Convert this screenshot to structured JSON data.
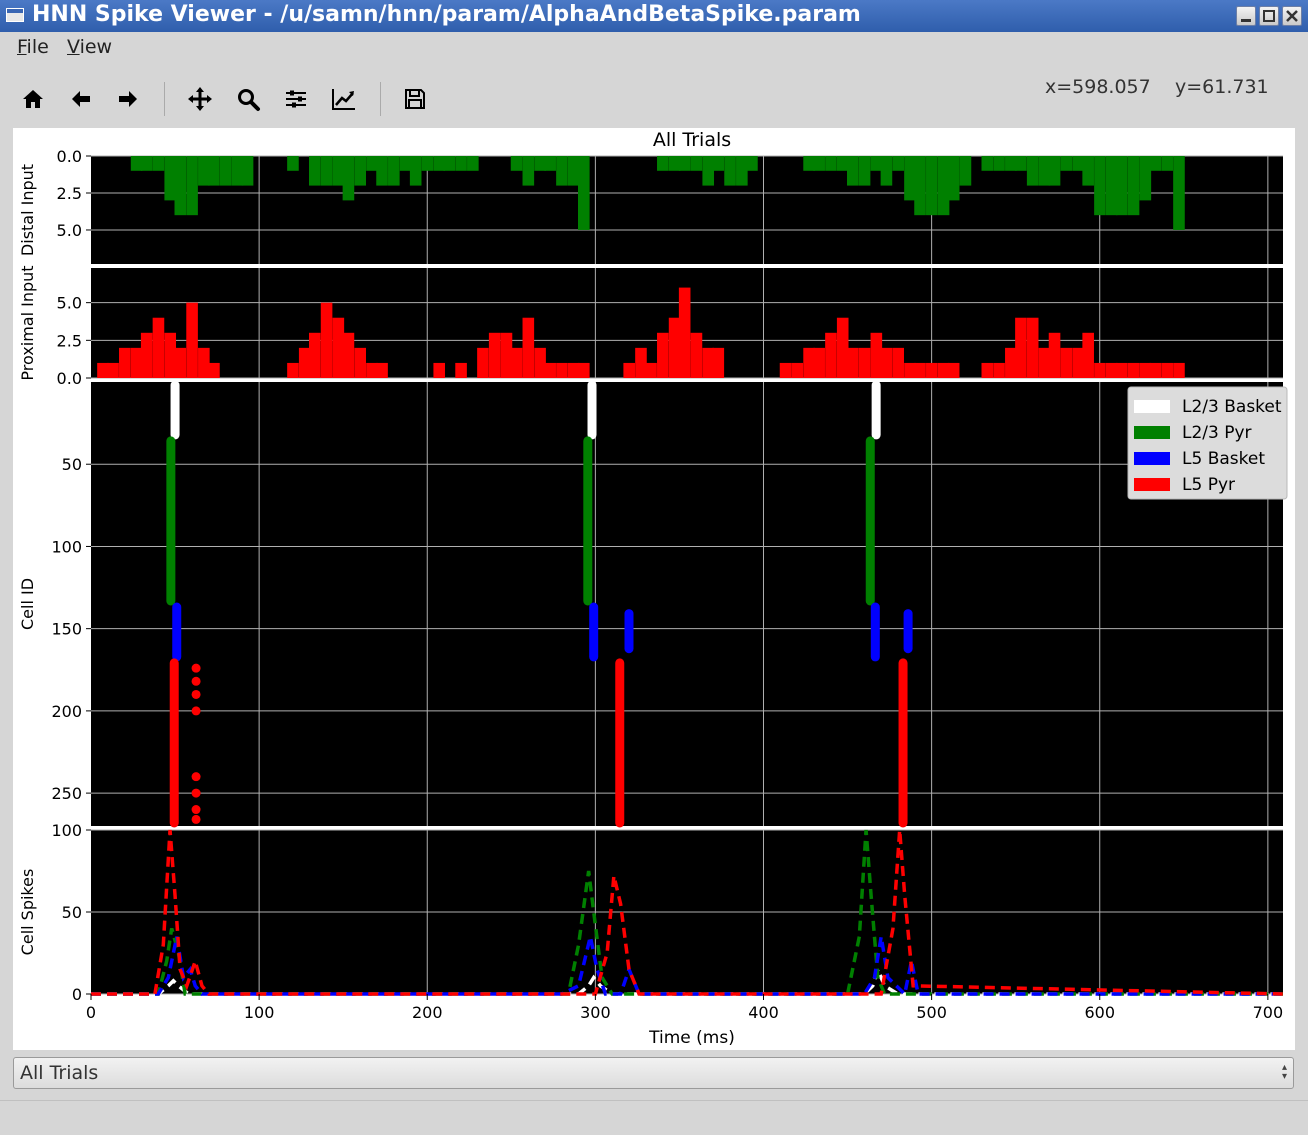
{
  "window": {
    "title": "HNN Spike Viewer - /u/samn/hnn/param/AlphaAndBetaSpike.param"
  },
  "menu": {
    "items": [
      {
        "first": "F",
        "rest": "ile"
      },
      {
        "first": "V",
        "rest": "iew"
      }
    ]
  },
  "toolbar": {
    "icons": [
      "home-icon",
      "back-arrow-icon",
      "forward-arrow-icon",
      "pan-icon",
      "zoom-icon",
      "subplots-config-icon",
      "edit-axis-icon",
      "save-icon"
    ],
    "coord_x": "x=598.057",
    "coord_y": "y=61.731"
  },
  "figure": {
    "title": "All Trials",
    "xlabel": "Time (ms)",
    "x_ticks": [
      "0",
      "100",
      "200",
      "300",
      "400",
      "500",
      "600",
      "700"
    ]
  },
  "chart_data": [
    {
      "type": "bar",
      "panel": "distal",
      "ylabel": "Distal Input",
      "ylim": [
        0,
        7.3
      ],
      "inverted_y": true,
      "y_ticks": [
        "0.0",
        "2.5",
        "5.0"
      ],
      "bin_width_ms": 6.66,
      "color": "#008000",
      "x": [
        27,
        33,
        40,
        47,
        53,
        60,
        67,
        73,
        80,
        87,
        93,
        120,
        133,
        140,
        147,
        153,
        160,
        167,
        173,
        180,
        187,
        193,
        200,
        207,
        213,
        220,
        227,
        253,
        260,
        267,
        273,
        280,
        287,
        293,
        340,
        347,
        353,
        360,
        367,
        373,
        380,
        387,
        393,
        427,
        433,
        440,
        447,
        453,
        460,
        467,
        473,
        480,
        487,
        493,
        500,
        507,
        513,
        520,
        533,
        540,
        547,
        553,
        560,
        567,
        573,
        580,
        587,
        593,
        600,
        607,
        613,
        620,
        627,
        633,
        640,
        647
      ],
      "values": [
        1,
        1,
        1,
        3,
        4,
        4,
        2,
        2,
        2,
        2,
        2,
        1,
        2,
        2,
        2,
        3,
        2,
        1,
        2,
        2,
        1,
        2,
        1,
        1,
        1,
        1,
        1,
        1,
        2,
        1,
        1,
        2,
        2,
        5,
        1,
        1,
        1,
        1,
        2,
        1,
        2,
        2,
        1,
        1,
        1,
        1,
        1,
        2,
        2,
        1,
        2,
        1,
        3,
        4,
        4,
        4,
        3,
        2,
        1,
        1,
        1,
        1,
        2,
        2,
        2,
        1,
        1,
        2,
        4,
        4,
        4,
        4,
        3,
        1,
        1,
        5
      ],
      "_note": "bars across the row as counts per bin"
    },
    {
      "type": "bar",
      "panel": "proximal",
      "ylabel": "Proximal Input",
      "ylim": [
        0,
        7.3
      ],
      "y_ticks": [
        "0.0",
        "2.5",
        "5.0"
      ],
      "bin_width_ms": 6.66,
      "color": "#ff0000",
      "x": [
        7,
        13,
        20,
        27,
        33,
        40,
        47,
        53,
        60,
        67,
        73,
        120,
        127,
        133,
        140,
        147,
        153,
        160,
        167,
        173,
        207,
        220,
        233,
        240,
        247,
        253,
        260,
        267,
        273,
        280,
        287,
        293,
        320,
        327,
        333,
        340,
        347,
        353,
        360,
        367,
        373,
        413,
        420,
        427,
        433,
        440,
        447,
        453,
        460,
        467,
        473,
        480,
        487,
        493,
        500,
        507,
        513,
        533,
        540,
        547,
        553,
        560,
        567,
        573,
        580,
        587,
        593,
        600,
        607,
        613,
        620,
        627,
        633,
        640,
        647
      ],
      "values": [
        1,
        1,
        2,
        2,
        3,
        4,
        3,
        2,
        5,
        2,
        1,
        1,
        2,
        3,
        5,
        4,
        3,
        2,
        1,
        1,
        1,
        1,
        2,
        3,
        3,
        2,
        4,
        2,
        1,
        1,
        1,
        1,
        1,
        2,
        1,
        3,
        4,
        6,
        3,
        2,
        2,
        1,
        1,
        2,
        2,
        3,
        4,
        2,
        2,
        3,
        2,
        2,
        1,
        1,
        1,
        1,
        1,
        1,
        1,
        2,
        4,
        4,
        2,
        3,
        2,
        2,
        3,
        1,
        1,
        1,
        1,
        1,
        1,
        1,
        1
      ],
      "_note": "bars across the row as counts per bin"
    },
    {
      "type": "scatter",
      "panel": "raster",
      "ylabel": "Cell ID",
      "ylim": [
        0,
        270
      ],
      "inverted_y": true,
      "y_ticks": [
        "50",
        "100",
        "150",
        "200",
        "250"
      ],
      "legend": {
        "placement": "top-right",
        "entries": [
          {
            "label": "L2/3 Basket",
            "color": "#ffffff"
          },
          {
            "label": "L2/3 Pyr",
            "color": "#008000"
          },
          {
            "label": "L5 Basket",
            "color": "#0000ff"
          },
          {
            "label": "L5 Pyr",
            "color": "#ff0000"
          }
        ]
      },
      "segments": [
        {
          "group": "L2/3 Basket",
          "color": "#ffffff",
          "x": 50,
          "y": [
            0,
            34
          ]
        },
        {
          "group": "L2/3 Pyr",
          "color": "#008000",
          "x": 47.5,
          "y": [
            34,
            135
          ]
        },
        {
          "group": "L5 Basket",
          "color": "#0000ff",
          "x": 51,
          "y": [
            135,
            169
          ]
        },
        {
          "group": "L5 Pyr",
          "color": "#ff0000",
          "x": 49.5,
          "y": [
            169,
            270
          ]
        },
        {
          "group": "L2/3 Basket",
          "color": "#ffffff",
          "x": 298,
          "y": [
            0,
            34
          ]
        },
        {
          "group": "L2/3 Pyr",
          "color": "#008000",
          "x": 295.5,
          "y": [
            34,
            135
          ]
        },
        {
          "group": "L5 Basket",
          "color": "#0000ff",
          "x": 299,
          "y": [
            135,
            169
          ]
        },
        {
          "group": "L5 Basket",
          "color": "#0000ff",
          "x": 320,
          "y": [
            139,
            164
          ]
        },
        {
          "group": "L5 Pyr",
          "color": "#ff0000",
          "x": 314.5,
          "y": [
            169,
            270
          ]
        },
        {
          "group": "L2/3 Basket",
          "color": "#ffffff",
          "x": 467,
          "y": [
            0,
            34
          ]
        },
        {
          "group": "L2/3 Pyr",
          "color": "#008000",
          "x": 463.5,
          "y": [
            34,
            135
          ]
        },
        {
          "group": "L5 Basket",
          "color": "#0000ff",
          "x": 466.5,
          "y": [
            135,
            169
          ]
        },
        {
          "group": "L5 Basket",
          "color": "#0000ff",
          "x": 486,
          "y": [
            139,
            164
          ]
        },
        {
          "group": "L5 Pyr",
          "color": "#ff0000",
          "x": 483,
          "y": [
            169,
            270
          ]
        }
      ],
      "dots": [
        {
          "color": "#ff0000",
          "x": 62.5,
          "y": [
            174,
            182,
            190,
            200,
            240,
            250,
            260,
            266
          ]
        }
      ]
    },
    {
      "type": "line",
      "panel": "counts",
      "ylabel": "Cell Spikes",
      "ylim": [
        0,
        100
      ],
      "y_ticks": [
        "0",
        "50",
        "100"
      ],
      "style": "dashed",
      "series": [
        {
          "color": "#ffffff",
          "x": [
            0,
            40,
            46,
            49,
            52,
            58,
            200,
            290,
            296,
            299,
            303,
            310,
            460,
            465,
            468,
            472,
            480,
            709
          ],
          "y": [
            0,
            0,
            5,
            8,
            5,
            0,
            0,
            0,
            5,
            10,
            5,
            0,
            0,
            5,
            15,
            5,
            0,
            0
          ]
        },
        {
          "color": "#008000",
          "x": [
            0,
            40,
            45,
            48,
            52,
            56,
            200,
            284,
            290,
            296,
            299,
            304,
            310,
            450,
            457,
            461,
            464,
            468,
            472,
            709
          ],
          "y": [
            0,
            0,
            20,
            40,
            25,
            0,
            0,
            0,
            30,
            75,
            50,
            10,
            0,
            0,
            35,
            100,
            60,
            10,
            0,
            0
          ]
        },
        {
          "color": "#0000ff",
          "x": [
            0,
            40,
            46,
            51,
            55,
            59,
            62,
            66,
            280,
            290,
            297,
            301,
            306,
            315,
            320,
            326,
            460,
            466,
            470,
            474,
            484,
            488,
            492,
            709
          ],
          "y": [
            0,
            0,
            10,
            35,
            10,
            15,
            5,
            0,
            0,
            5,
            35,
            15,
            0,
            0,
            15,
            0,
            0,
            10,
            35,
            10,
            0,
            20,
            0,
            0
          ]
        },
        {
          "color": "#ff0000",
          "x": [
            0,
            38,
            43,
            47,
            50,
            53,
            57,
            62,
            66,
            70,
            300,
            307,
            311,
            315,
            320,
            326,
            470,
            477,
            481,
            484,
            489,
            709
          ],
          "y": [
            0,
            0,
            30,
            100,
            60,
            15,
            5,
            20,
            5,
            0,
            0,
            25,
            72,
            55,
            15,
            0,
            0,
            40,
            100,
            60,
            5,
            0
          ]
        }
      ]
    }
  ],
  "combo": {
    "value": "All Trials"
  }
}
